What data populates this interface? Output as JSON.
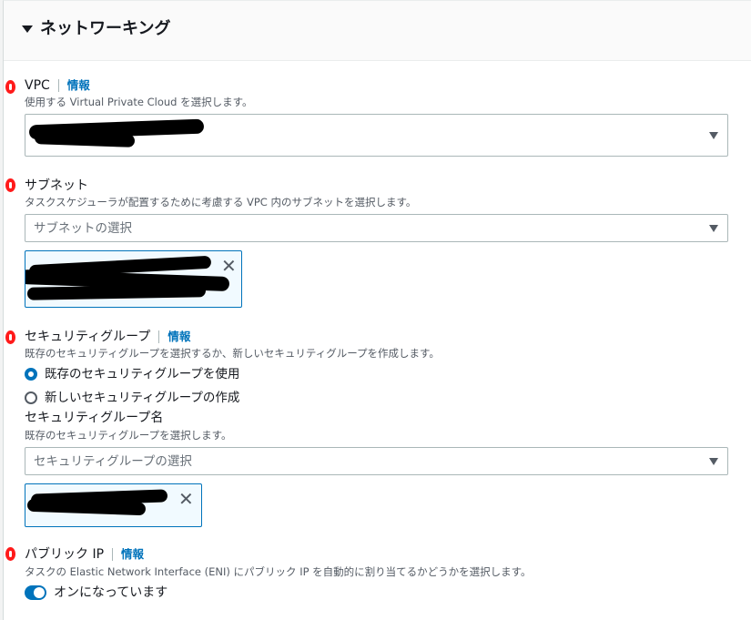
{
  "section": {
    "title": "ネットワーキング"
  },
  "vpc": {
    "label": "VPC",
    "info": "情報",
    "description": "使用する Virtual Private Cloud を選択します。"
  },
  "subnet": {
    "label": "サブネット",
    "description": "タスクスケジューラが配置するために考慮する VPC 内のサブネットを選択します。",
    "placeholder": "サブネットの選択"
  },
  "security_group": {
    "label": "セキュリティグループ",
    "info": "情報",
    "description": "既存のセキュリティグループを選択するか、新しいセキュリティグループを作成します。",
    "options": [
      {
        "label": "既存のセキュリティグループを使用",
        "selected": true
      },
      {
        "label": "新しいセキュリティグループの作成",
        "selected": false
      }
    ],
    "name_label": "セキュリティグループ名",
    "name_description": "既存のセキュリティグループを選択します。",
    "placeholder": "セキュリティグループの選択"
  },
  "public_ip": {
    "label": "パブリック IP",
    "info": "情報",
    "description": "タスクの Elastic Network Interface (ENI) にパブリック IP を自動的に割り当てるかどうかを選択します。",
    "toggle_label": "オンになっています",
    "enabled": true
  },
  "icons": {
    "expand": "caret-down-icon",
    "dropdown": "dropdown-arrow-icon",
    "dismiss": "close-icon",
    "marker": "red-marker-icon"
  },
  "colors": {
    "link": "#0073bb",
    "accent": "#0073bb",
    "marker": "#ff1a1a",
    "token_bg": "#f1faff"
  }
}
